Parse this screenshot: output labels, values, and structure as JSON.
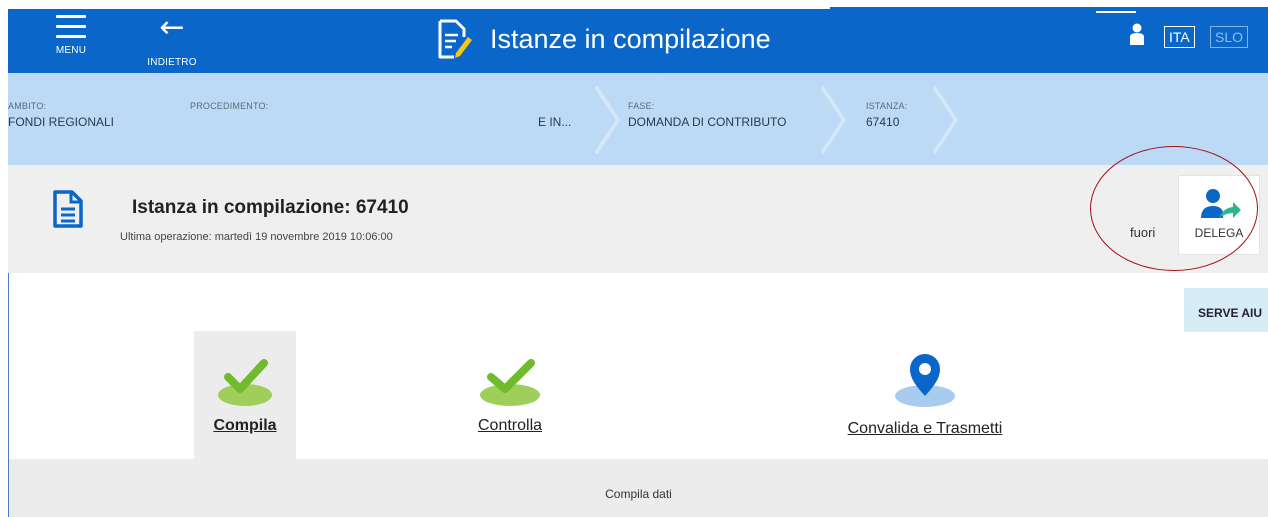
{
  "header": {
    "menu_label": "MENU",
    "back_label": "INDIETRO",
    "title": "Istanze in compilazione",
    "lang_active": "ITA",
    "lang_other": "SLO",
    "colors": {
      "bar": "#0a67c9",
      "breadcrumb": "#bcdaf5"
    }
  },
  "breadcrumb": {
    "items": [
      {
        "key": "AMBITO:",
        "value": "FONDI REGIONALI"
      },
      {
        "key": "PROCEDIMENTO:",
        "value": "E IN..."
      },
      {
        "key": "FASE:",
        "value": "DOMANDA DI CONTRIBUTO"
      },
      {
        "key": "ISTANZA:",
        "value": "67410"
      }
    ]
  },
  "istanza": {
    "title": "Istanza in compilazione: 67410",
    "last_op": "Ultima operazione: martedì 19 novembre 2019 10:06:00",
    "fuori_label": "fuori",
    "delega_label": "DELEGA"
  },
  "help": {
    "label": "SERVE AIU"
  },
  "steps": [
    {
      "label": "Compila",
      "state": "done",
      "icon": "check-icon"
    },
    {
      "label": "Controlla",
      "state": "done",
      "icon": "check-icon"
    },
    {
      "label": "Convalida e Trasmetti",
      "state": "pending",
      "icon": "location-pin-icon"
    }
  ],
  "bottom": {
    "label": "Compila dati"
  }
}
